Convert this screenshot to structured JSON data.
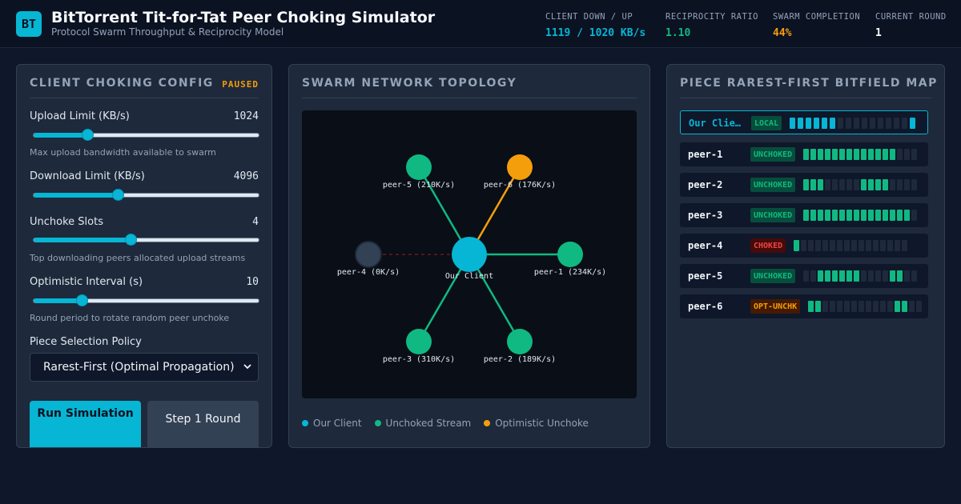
{
  "header": {
    "logo": "BT",
    "title": "BitTorrent Tit-for-Tat Peer Choking Simulator",
    "subtitle": "Protocol Swarm Throughput & Reciprocity Model",
    "stats": [
      {
        "label": "CLIENT DOWN / UP",
        "value": "1119 / 1020 KB/s",
        "color": "#06b6d4"
      },
      {
        "label": "RECIPROCITY RATIO",
        "value": "1.10",
        "color": "#10b981"
      },
      {
        "label": "SWARM COMPLETION",
        "value": "44%",
        "color": "#f59e0b"
      },
      {
        "label": "CURRENT ROUND",
        "value": "1",
        "color": "#f8fafc"
      }
    ]
  },
  "config": {
    "title": "CLIENT CHOKING CONFIG",
    "status": "PAUSED",
    "controls": [
      {
        "label": "Upload Limit (KB/s)",
        "value": "1024",
        "level": 0.24,
        "hint": "Max upload bandwidth available to swarm"
      },
      {
        "label": "Download Limit (KB/s)",
        "value": "4096",
        "level": 0.375,
        "hint": ""
      },
      {
        "label": "Unchoke Slots",
        "value": "4",
        "level": 0.43,
        "hint": "Top downloading peers allocated upload streams"
      },
      {
        "label": "Optimistic Interval (s)",
        "value": "10",
        "level": 0.215,
        "hint": "Round period to rotate random peer unchoke"
      }
    ],
    "policy_label": "Piece Selection Policy",
    "policy_value": "Rarest-First (Optimal Propagation)",
    "run_label": "Run Simulation",
    "step_label": "Step 1 Round"
  },
  "topology": {
    "title": "SWARM NETWORK TOPOLOGY",
    "center_label": "Our Client",
    "peers": [
      {
        "label": "peer-5 (210K/s)",
        "state": "unchoked"
      },
      {
        "label": "peer-6 (176K/s)",
        "state": "optimistic"
      },
      {
        "label": "peer-4 (0K/s)",
        "state": "choked"
      },
      {
        "label": "peer-1 (234K/s)",
        "state": "unchoked"
      },
      {
        "label": "peer-3 (310K/s)",
        "state": "unchoked"
      },
      {
        "label": "peer-2 (189K/s)",
        "state": "unchoked"
      }
    ],
    "legend": [
      {
        "label": "Our Client",
        "color": "#06b6d4"
      },
      {
        "label": "Unchoked Stream",
        "color": "#10b981"
      },
      {
        "label": "Optimistic Unchoke",
        "color": "#f59e0b"
      }
    ]
  },
  "bitfield": {
    "title": "PIECE RAREST-FIRST BITFIELD MAP",
    "rows": [
      {
        "name": "Our Client",
        "badge": "LOCAL",
        "badge_color": "#10b981",
        "badge_bg": "#064e3b",
        "fill": "#06b6d4",
        "bits": "1111110000000001"
      },
      {
        "name": "peer-1",
        "badge": "UNCHOKED",
        "badge_color": "#10b981",
        "badge_bg": "#064e3b",
        "fill": "#10b981",
        "bits": "1111111111111000"
      },
      {
        "name": "peer-2",
        "badge": "UNCHOKED",
        "badge_color": "#10b981",
        "badge_bg": "#064e3b",
        "fill": "#10b981",
        "bits": "1110000011110000"
      },
      {
        "name": "peer-3",
        "badge": "UNCHOKED",
        "badge_color": "#10b981",
        "badge_bg": "#064e3b",
        "fill": "#10b981",
        "bits": "1111111111111110"
      },
      {
        "name": "peer-4",
        "badge": "CHOKED",
        "badge_color": "#ef4444",
        "badge_bg": "#450a0a",
        "fill": "#10b981",
        "bits": "1000000000000000"
      },
      {
        "name": "peer-5",
        "badge": "UNCHOKED",
        "badge_color": "#10b981",
        "badge_bg": "#064e3b",
        "fill": "#10b981",
        "bits": "0011111100001100"
      },
      {
        "name": "peer-6",
        "badge": "OPT-UNCHK",
        "badge_color": "#f59e0b",
        "badge_bg": "#451a03",
        "fill": "#10b981",
        "bits": "1100000000001100"
      }
    ]
  }
}
